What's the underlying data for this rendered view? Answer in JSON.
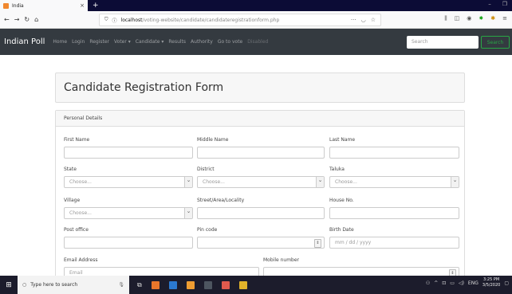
{
  "browser": {
    "tab_title": "India",
    "tab_close": "×",
    "new_tab": "+",
    "url_host": "localhost",
    "url_path": "/voting-website/candidate/candidateregistrationform.php",
    "window_min": "–",
    "window_restore": "❐"
  },
  "app": {
    "brand": "Indian Poll",
    "menu": [
      {
        "label": "Home"
      },
      {
        "label": "Login"
      },
      {
        "label": "Register"
      },
      {
        "label": "Voter ▾"
      },
      {
        "label": "Candidate ▾"
      },
      {
        "label": "Results"
      },
      {
        "label": "Authority"
      },
      {
        "label": "Go to vote"
      },
      {
        "label": "Disabled"
      }
    ],
    "search_placeholder": "Search",
    "search_button": "Search"
  },
  "form": {
    "title": "Candidate Registration Form",
    "section_title": "Personal Details",
    "first_name": "First Name",
    "middle_name": "Middle Name",
    "last_name": "Last Name",
    "state": "State",
    "district": "District",
    "taluka": "Taluka",
    "choose": "Choose...",
    "village": "Village",
    "street": "Street/Area/Locality",
    "house_no": "House No.",
    "post_office": "Post office",
    "pin_code": "Pin code",
    "birth_date": "Birth Date",
    "birth_placeholder": "mm / dd / yyyy",
    "email": "Email Address",
    "email_placeholder": "Email",
    "mobile": "Mobile number"
  },
  "taskbar": {
    "search_placeholder": "Type here to search",
    "language": "ENG",
    "time": "3:25 PM",
    "date": "3/5/2020"
  }
}
